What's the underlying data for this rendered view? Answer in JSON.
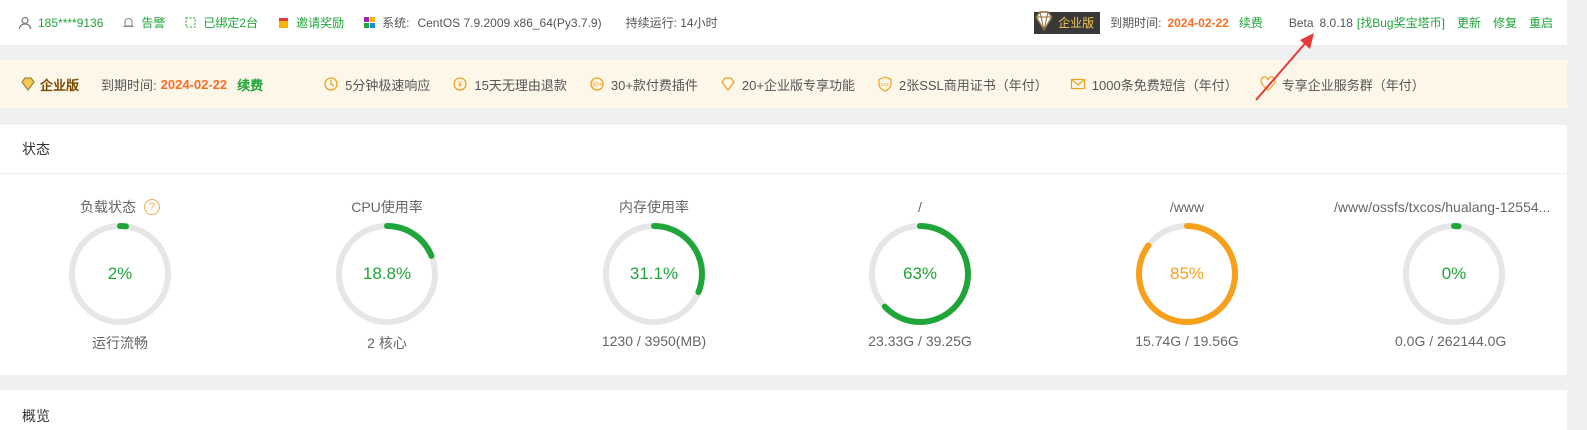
{
  "topbar": {
    "user": "185****9136",
    "alarm": "告警",
    "bound": "已绑定2台",
    "invite": "邀请奖励",
    "system_label": "系统:",
    "system_value": "CentOS 7.9.2009 x86_64(Py3.7.9)",
    "uptime": "持续运行: 14小时",
    "edition": "企业版",
    "expire_label": "到期时间:",
    "expire_date": "2024-02-22",
    "renew": "续费",
    "beta": "Beta",
    "version": "8.0.18",
    "bug": "[找Bug奖宝塔币]",
    "update": "更新",
    "repair": "修复",
    "restart": "重启"
  },
  "promo": {
    "edition": "企业版",
    "expire_label": "到期时间:",
    "expire_date": "2024-02-22",
    "renew": "续费",
    "features": [
      "5分钟极速响应",
      "15天无理由退款",
      "30+款付费插件",
      "20+企业版专享功能",
      "2张SSL商用证书（年付）",
      "1000条免费短信（年付）",
      "专享企业服务群（年付）"
    ]
  },
  "status": {
    "title": "状态",
    "gauges": [
      {
        "label": "负载状态",
        "value": "2%",
        "percent": 2,
        "sub": "运行流畅",
        "color": "#20a53a",
        "help": "?"
      },
      {
        "label": "CPU使用率",
        "value": "18.8%",
        "percent": 18.8,
        "sub": "2 核心",
        "color": "#20a53a"
      },
      {
        "label": "内存使用率",
        "value": "31.1%",
        "percent": 31.1,
        "sub": "1230 / 3950(MB)",
        "color": "#20a53a"
      },
      {
        "label": "/",
        "value": "63%",
        "percent": 63,
        "sub": "23.33G / 39.25G",
        "color": "#20a53a"
      },
      {
        "label": "/www",
        "value": "85%",
        "percent": 85,
        "sub": "15.74G / 19.56G",
        "color": "#f7a01c"
      },
      {
        "label": "/www/ossfs/txcos/hualang-12554...",
        "value": "0%",
        "percent": 0,
        "sub": "0.0G / 262144.0G",
        "color": "#20a53a"
      }
    ]
  },
  "overview": {
    "title": "概览"
  },
  "colors": {
    "accent_green": "#20a53a",
    "accent_orange": "#fc6d26",
    "warn": "#f7a01c",
    "arrow": "#e53935"
  }
}
